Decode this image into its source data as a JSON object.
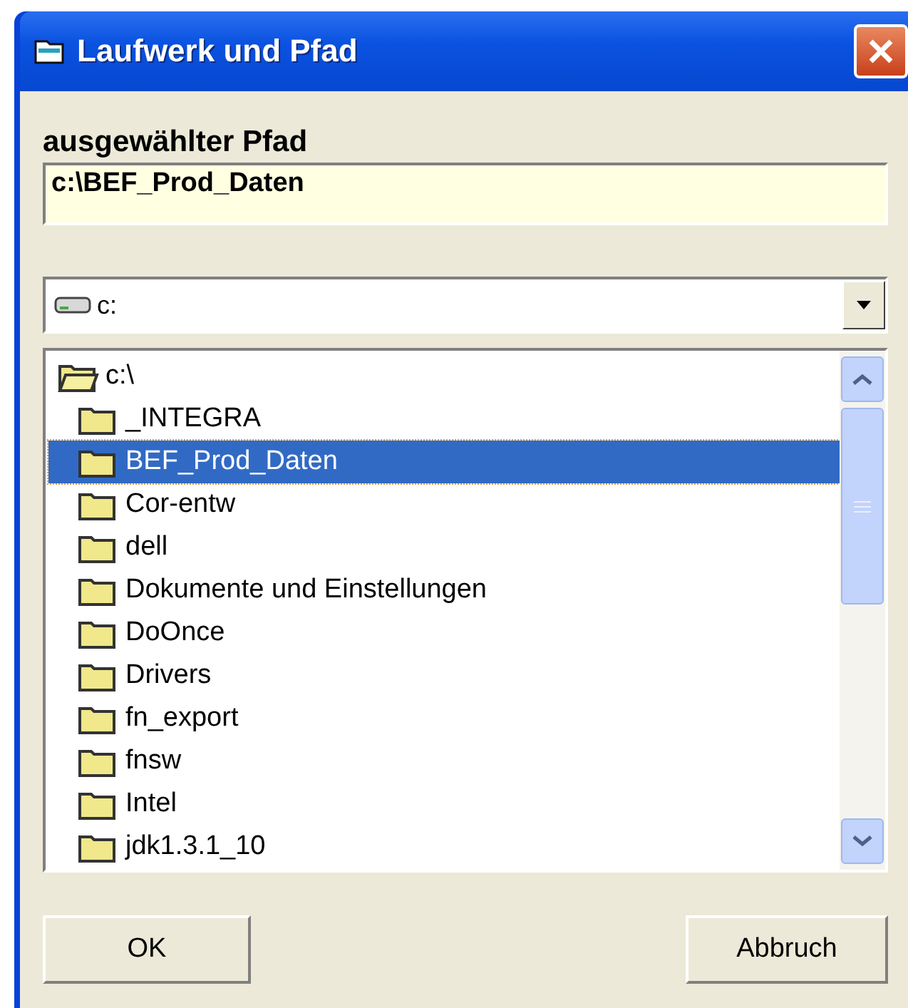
{
  "window": {
    "title": "Laufwerk und Pfad"
  },
  "path": {
    "label": "ausgewählter Pfad",
    "value": "c:\\BEF_Prod_Daten"
  },
  "drive": {
    "value": "c:"
  },
  "tree": [
    {
      "label": "c:\\",
      "selected": false,
      "expanded": true,
      "children": [
        {
          "label": "_INTEGRA",
          "selected": false
        },
        {
          "label": "BEF_Prod_Daten",
          "selected": true
        },
        {
          "label": "Cor-entw",
          "selected": false
        },
        {
          "label": "dell",
          "selected": false
        },
        {
          "label": "Dokumente und Einstellungen",
          "selected": false
        },
        {
          "label": "DoOnce",
          "selected": false
        },
        {
          "label": "Drivers",
          "selected": false
        },
        {
          "label": "fn_export",
          "selected": false
        },
        {
          "label": "fnsw",
          "selected": false
        },
        {
          "label": "Intel",
          "selected": false
        },
        {
          "label": "jdk1.3.1_10",
          "selected": false
        }
      ]
    }
  ],
  "buttons": [
    {
      "label": "OK"
    },
    {
      "label": "Abbruch"
    }
  ]
}
